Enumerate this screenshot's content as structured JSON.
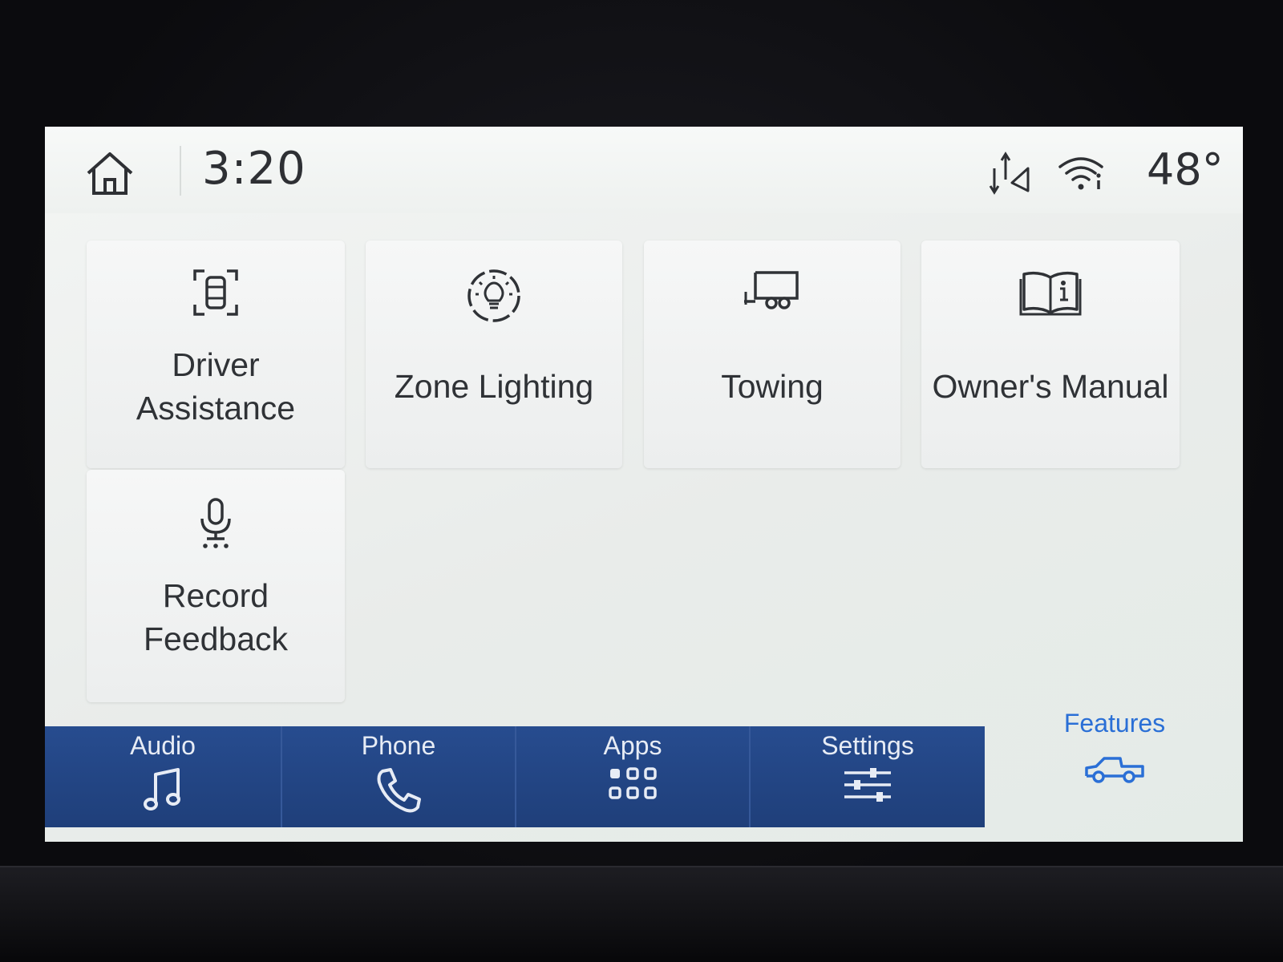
{
  "status_bar": {
    "time": "3:20",
    "temperature": "48°",
    "icons": [
      "home-icon",
      "navigation-status-icon",
      "wifi-info-icon"
    ]
  },
  "tiles": [
    {
      "line1": "Driver",
      "line2": "Assistance",
      "icon": "driver-assist-icon"
    },
    {
      "label": "Zone Lighting",
      "icon": "zone-lighting-icon"
    },
    {
      "label": "Towing",
      "icon": "trailer-icon"
    },
    {
      "label": "Owner's Manual",
      "icon": "book-info-icon"
    },
    {
      "line1": "Record",
      "line2": "Feedback",
      "icon": "microphone-icon"
    }
  ],
  "bottom_nav": {
    "tabs": [
      {
        "label": "Audio",
        "icon": "music-note-icon"
      },
      {
        "label": "Phone",
        "icon": "phone-icon"
      },
      {
        "label": "Apps",
        "icon": "apps-grid-icon"
      },
      {
        "label": "Settings",
        "icon": "sliders-icon"
      },
      {
        "label": "Features",
        "icon": "truck-icon",
        "selected": true
      }
    ]
  },
  "colors": {
    "nav_background": "#274c8f",
    "selected_accent": "#2a6fd6",
    "text_primary": "#2f3236",
    "nav_text": "#e7ecf5"
  }
}
